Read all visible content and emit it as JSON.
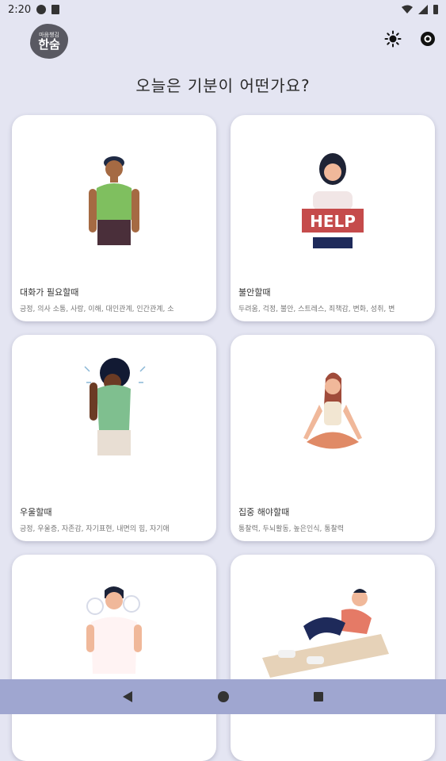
{
  "status_bar": {
    "time": "2:20",
    "icons": [
      "gear-icon",
      "sd-card-icon",
      "wifi-icon",
      "signal-icon",
      "battery-icon"
    ]
  },
  "header": {
    "logo_small_text": "마음챙김",
    "logo_text": "한숨",
    "theme_icon": "sun-icon",
    "settings_icon": "settings-icon"
  },
  "title": "오늘은 기분이 어떤가요?",
  "cards": [
    {
      "title": "대화가 필요할때",
      "tags": "긍정, 의사 소통, 사랑, 이해, 대인관계, 인간관계, 소",
      "illustration": "man-green-shirt"
    },
    {
      "title": "불안할때",
      "tags": "두려움, 걱정, 불안, 스트레스, 죄책감, 변화, 성취, 변",
      "illustration": "woman-help-sign"
    },
    {
      "title": "우울할때",
      "tags": "긍정, 우울증, 자존감, 자기표현, 내면의 힘, 자기애",
      "illustration": "distressed-woman"
    },
    {
      "title": "집중 해야할때",
      "tags": "통찰력, 두뇌활동, 높은인식, 통찰력",
      "illustration": "meditating-woman"
    },
    {
      "title": "",
      "tags": "",
      "illustration": "angry-man"
    },
    {
      "title": "",
      "tags": "",
      "illustration": "exercising-man"
    }
  ],
  "colors": {
    "background": "#e4e5f2",
    "card": "#ffffff",
    "nav_bar": "#9fa6d0",
    "logo": "#595962"
  },
  "nav": {
    "back_icon": "back-triangle-icon",
    "home_icon": "home-circle-icon",
    "recents_icon": "recents-square-icon"
  }
}
